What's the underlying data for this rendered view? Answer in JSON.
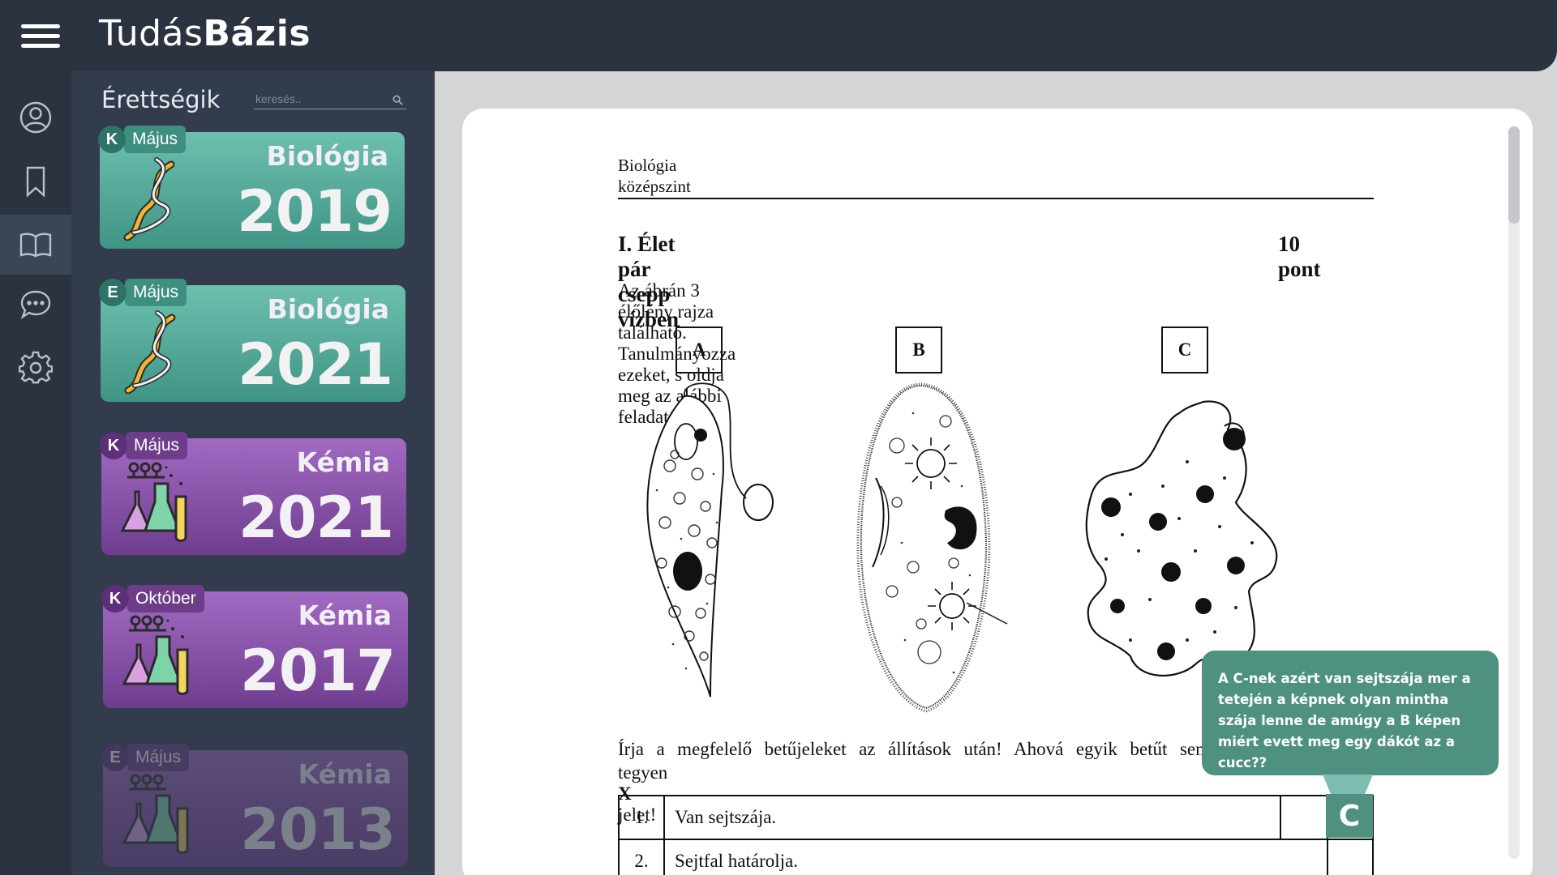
{
  "app": {
    "logo_regular": "Tudás",
    "logo_bold": "Bázis"
  },
  "rail": {
    "items": [
      {
        "icon": "user-circle-icon"
      },
      {
        "icon": "bookmark-icon"
      },
      {
        "icon": "book-open-icon",
        "active": true
      },
      {
        "icon": "chat-bubble-icon"
      },
      {
        "icon": "gear-icon"
      }
    ]
  },
  "sidebar": {
    "title": "Érettségik",
    "search_placeholder": "keresés..",
    "cards": [
      {
        "level": "K",
        "month": "Május",
        "subject": "Biológia",
        "year": "2019",
        "icon": "dna-icon",
        "color": "teal"
      },
      {
        "level": "E",
        "month": "Május",
        "subject": "Biológia",
        "year": "2021",
        "icon": "dna-icon",
        "color": "teal"
      },
      {
        "level": "K",
        "month": "Május",
        "subject": "Kémia",
        "year": "2021",
        "icon": "flasks-icon",
        "color": "purple"
      },
      {
        "level": "K",
        "month": "Október",
        "subject": "Kémia",
        "year": "2017",
        "icon": "flasks-icon",
        "color": "purple"
      },
      {
        "level": "E",
        "month": "Május",
        "subject": "Kémia",
        "year": "2013",
        "icon": "flasks-icon",
        "color": "purple",
        "faded": true
      }
    ]
  },
  "document": {
    "header_line1": "Biológia",
    "header_line2": "középszint",
    "section_title": "I. Élet pár csepp vízben",
    "section_points": "10 pont",
    "intro": "Az ábrán 3 élőlény rajza található. Tanulmányozza ezeket, s oldja meg az alábbi feladatokat!",
    "figure_labels": [
      "A",
      "B",
      "C"
    ],
    "instruction_line1": "Írja a megfelelő betűjeleket az állítások után! Ahová egyik betűt sem",
    "instruction_line2_pre": "tegyen ",
    "instruction_line2_bold": "X",
    "instruction_line2_post": " jelet!",
    "rows": [
      {
        "num": "1.",
        "text": "Van sejtszája."
      },
      {
        "num": "2.",
        "text": "Sejtfal határolja."
      }
    ]
  },
  "tooltip": {
    "text": "A C-nek azért van sejtszája mer a tetején a képnek olyan mintha szája lenne de amúgy a B képen miért evett meg egy dákót az a cucc??",
    "answer": "C"
  },
  "colors": {
    "topbar": "#2b3240",
    "sidebar": "#323c4c",
    "teal_card": "#4e9e8e",
    "purple_card": "#8a52a9",
    "tooltip": "#4e9181"
  }
}
